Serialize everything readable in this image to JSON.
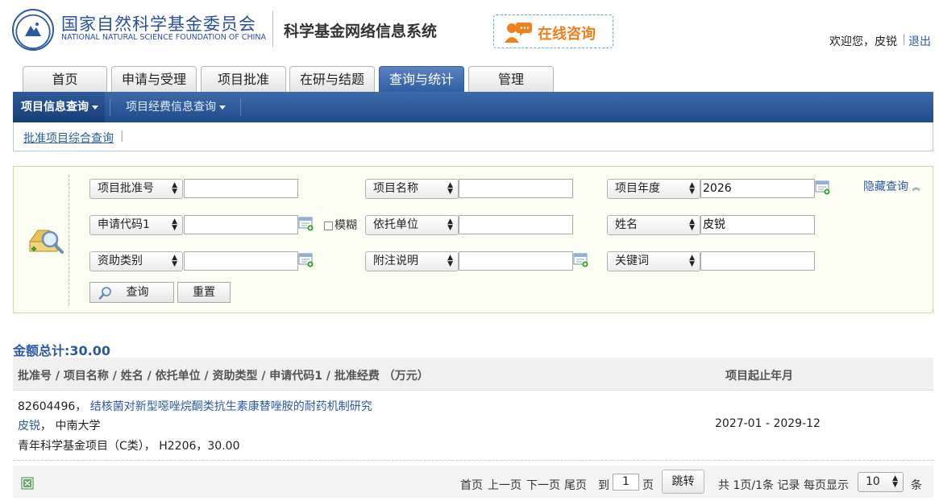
{
  "header": {
    "org_name_cn": "国家自然科学基金委员会",
    "org_name_en": "NATIONAL NATURAL SCIENCE FOUNDATION OF CHINA",
    "system_name": "科学基金网络信息系统",
    "consult_label": "在线咨询",
    "welcome": "欢迎您，皮锐",
    "logout": "退出"
  },
  "tabs": [
    {
      "label": "首页"
    },
    {
      "label": "申请与受理"
    },
    {
      "label": "项目批准"
    },
    {
      "label": "在研与结题"
    },
    {
      "label": "查询与统计",
      "active": true
    },
    {
      "label": "管理"
    }
  ],
  "subnav": [
    {
      "label": "项目信息查询",
      "active": true
    },
    {
      "label": "项目经费信息查询"
    }
  ],
  "breadcrumb": {
    "link": "批准项目综合查询"
  },
  "search": {
    "fields": [
      {
        "select": "项目批准号",
        "value": ""
      },
      {
        "select": "项目名称",
        "value": ""
      },
      {
        "select": "项目年度",
        "value": "2026"
      },
      {
        "select": "申请代码1",
        "value": ""
      },
      {
        "select": "依托单位",
        "value": ""
      },
      {
        "select": "姓名",
        "value": "皮锐"
      },
      {
        "select": "资助类别",
        "value": ""
      },
      {
        "select": "附注说明",
        "value": ""
      },
      {
        "select": "关键词",
        "value": ""
      }
    ],
    "fuzzy_label": "模糊",
    "hide_label": "隐藏查询",
    "query_button": "查询",
    "reset_button": "重置"
  },
  "results": {
    "total_label": "金额总计:",
    "total_value": "30.00",
    "header_main": "批准号 / 项目名称 / 姓名 / 依托单位 / 资助类型 / 申请代码1 / 批准经费 （万元）",
    "header_period": "项目起止年月",
    "rows": [
      {
        "approval_no": "82604496",
        "title": "结核菌对新型噁唑烷酮类抗生素康替唑胺的耐药机制研究",
        "pi": "皮锐",
        "institution": "中南大学",
        "funding_type": "青年科学基金项目（C类）",
        "code": "H2206",
        "amount": "30.00",
        "period": "2027-01 - 2029-12"
      }
    ]
  },
  "pager": {
    "first": "首页",
    "prev": "上一页",
    "next": "下一页",
    "last": "尾页",
    "goto_prefix": "到",
    "page_input": "1",
    "page_suffix": "页",
    "jump": "跳转",
    "summary": "共 1页/1条 记录",
    "per_page_label": "每页显示",
    "per_page": "10",
    "per_page_unit": "条"
  },
  "colors": {
    "brand_blue": "#2b5aa3",
    "nav_blue": "#1f4b8a",
    "consult_orange": "#f07f1c"
  }
}
